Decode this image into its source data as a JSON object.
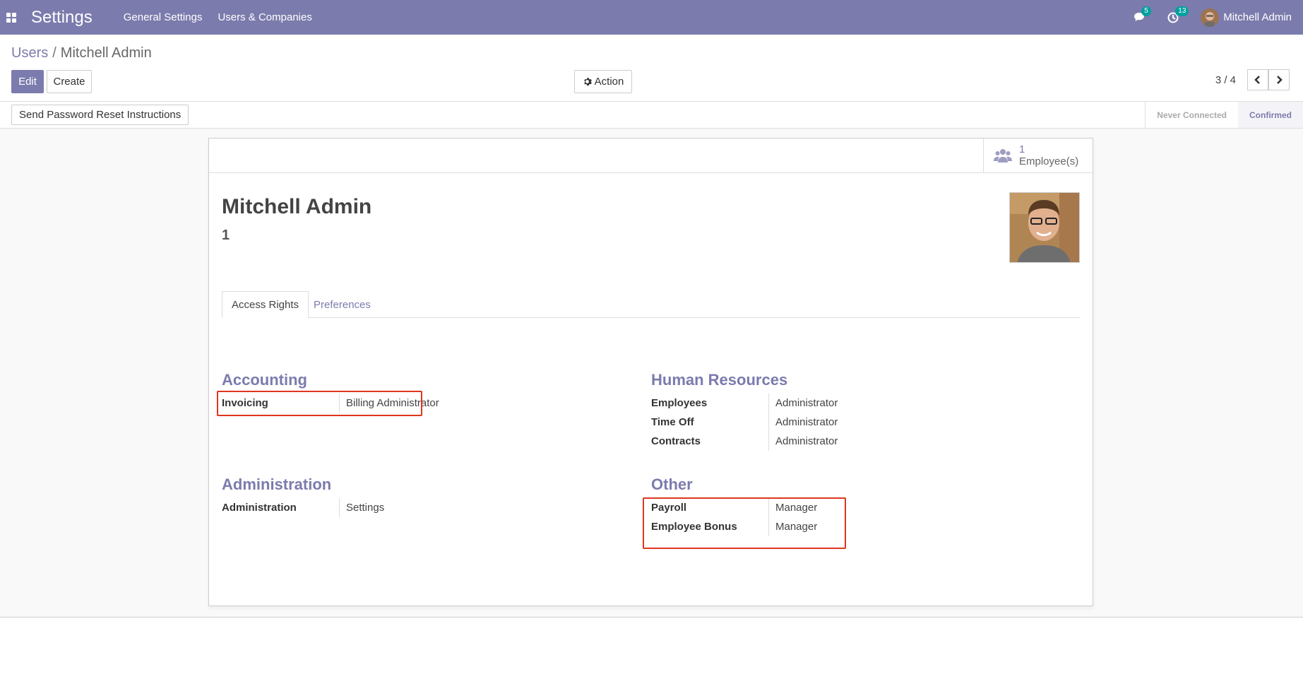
{
  "navbar": {
    "app_title": "Settings",
    "menu": [
      "General Settings",
      "Users & Companies"
    ],
    "messages_count": "5",
    "activities_count": "13",
    "user_name": "Mitchell Admin",
    "color": "#7c7bad"
  },
  "breadcrumb": {
    "parent": "Users",
    "separator": "/",
    "current": "Mitchell Admin"
  },
  "control": {
    "edit_label": "Edit",
    "create_label": "Create",
    "action_label": "Action",
    "pager": "3 / 4"
  },
  "statusbar": {
    "reset_button": "Send Password Reset Instructions",
    "steps": [
      "Never Connected",
      "Confirmed"
    ],
    "active_step": "Confirmed"
  },
  "stat_button": {
    "count": "1",
    "label": "Employee(s)"
  },
  "record": {
    "name": "Mitchell Admin",
    "subtitle": "1"
  },
  "tabs": [
    "Access Rights",
    "Preferences"
  ],
  "groups": {
    "accounting": {
      "title": "Accounting",
      "fields": [
        {
          "label": "Invoicing",
          "value": "Billing Administrator"
        }
      ]
    },
    "human_resources": {
      "title": "Human Resources",
      "fields": [
        {
          "label": "Employees",
          "value": "Administrator"
        },
        {
          "label": "Time Off",
          "value": "Administrator"
        },
        {
          "label": "Contracts",
          "value": "Administrator"
        }
      ]
    },
    "administration": {
      "title": "Administration",
      "fields": [
        {
          "label": "Administration",
          "value": "Settings"
        }
      ]
    },
    "other": {
      "title": "Other",
      "fields": [
        {
          "label": "Payroll",
          "value": "Manager"
        },
        {
          "label": "Employee Bonus",
          "value": "Manager"
        }
      ]
    }
  },
  "highlight_color": "#e0361f"
}
